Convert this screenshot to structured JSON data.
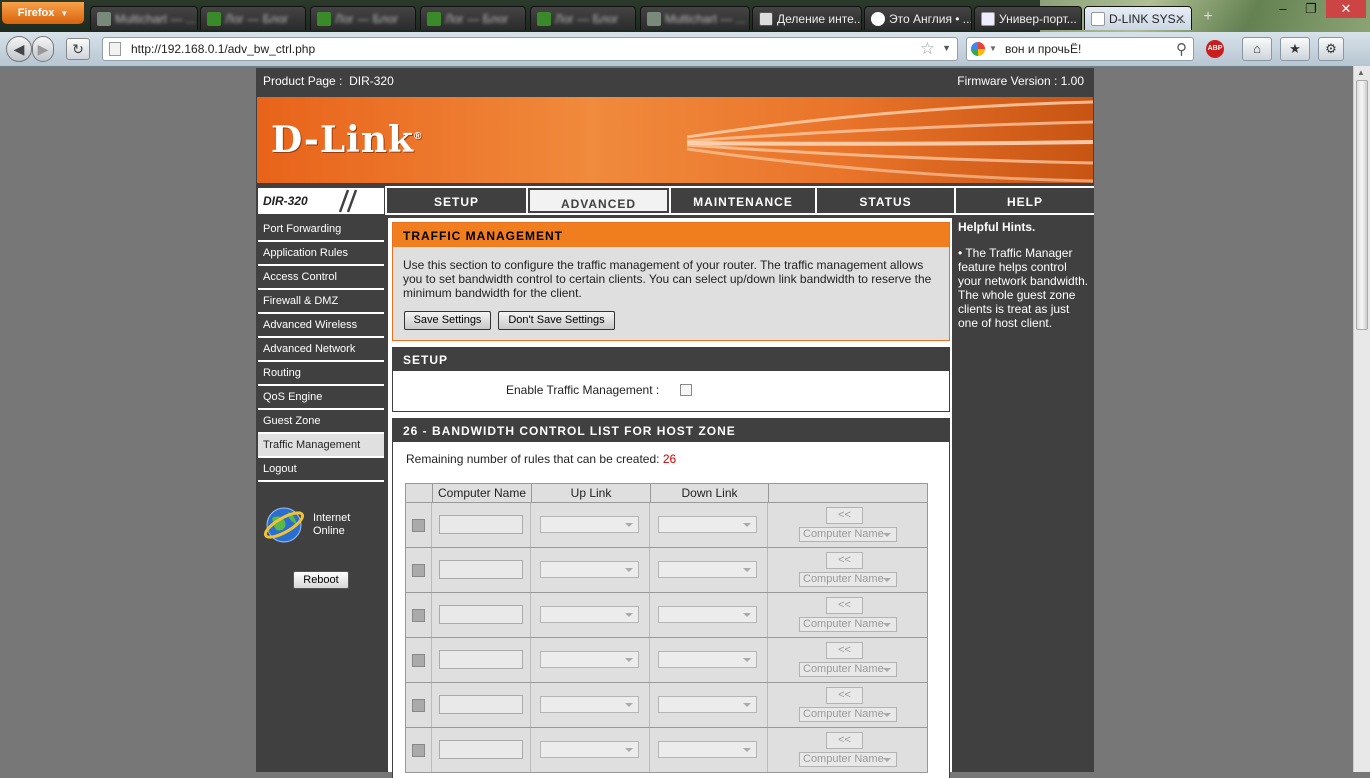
{
  "browser": {
    "firefox_label": "Firefox",
    "tabs": [
      {
        "title": "Multichart — ..."
      },
      {
        "title": "Лог — Блог"
      },
      {
        "title": "Лог — Блог"
      },
      {
        "title": "Лог — Блог"
      },
      {
        "title": "Лог — Блог"
      },
      {
        "title": "Multichart — ..."
      },
      {
        "title": "Деление инте..."
      },
      {
        "title": "Это Англия • ..."
      },
      {
        "title": "Универ-порт..."
      },
      {
        "title": "D-LINK SYS..."
      }
    ],
    "close_glyph": "✕",
    "newtab_glyph": "+",
    "url": "http://192.168.0.1/adv_bw_ctrl.php",
    "search_text": "вон и прочьЁ!",
    "abp_label": "ABP",
    "colors": {
      "firefox_button": "#e8751a",
      "active_tab": "#dbe4ee"
    }
  },
  "router": {
    "product_label": "Product Page :",
    "product_value": "DIR-320",
    "firmware_label": "Firmware Version :",
    "firmware_value": "1.00",
    "brand": "D-Link",
    "brand_reg": "®",
    "model": "DIR-320",
    "nav": [
      "SETUP",
      "ADVANCED",
      "MAINTENANCE",
      "STATUS",
      "HELP"
    ],
    "active_nav": "ADVANCED",
    "sidebar": [
      "Port Forwarding",
      "Application Rules",
      "Access Control",
      "Firewall & DMZ",
      "Advanced Wireless",
      "Advanced Network",
      "Routing",
      "QoS Engine",
      "Guest Zone",
      "Traffic Management",
      "Logout"
    ],
    "active_sidebar": "Traffic Management",
    "internet_status_line1": "Internet",
    "internet_status_line2": "Online",
    "reboot_label": "Reboot",
    "colors": {
      "orange": "#f07e1f",
      "dark": "#404040"
    }
  },
  "traffic": {
    "title": "TRAFFIC MANAGEMENT",
    "description": "Use this section to configure the traffic management of your router. The traffic management allows you to set bandwidth control to certain clients. You can select up/down link bandwidth to reserve the minimum bandwidth for the client.",
    "save_label": "Save Settings",
    "dont_save_label": "Don't Save Settings"
  },
  "setup": {
    "title": "SETUP",
    "enable_label": "Enable Traffic Management :",
    "enabled": false
  },
  "bandwidth": {
    "title": "26 - BANDWIDTH CONTROL LIST FOR HOST ZONE",
    "remaining_label": "Remaining number of rules that can be created:",
    "remaining_count": "26",
    "columns": [
      "",
      "Computer Name",
      "Up Link",
      "Down Link",
      ""
    ],
    "copy_button": "<<",
    "computer_name_select": "Computer Name",
    "visible_rows": 6
  },
  "help": {
    "title": "Helpful Hints.",
    "body": "• The Traffic Manager feature helps control your network bandwidth. The whole guest zone clients is treat as just one of host client."
  }
}
